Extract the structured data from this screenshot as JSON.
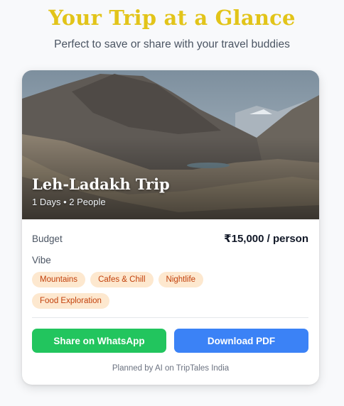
{
  "header": {
    "title": "Your Trip at a Glance",
    "subtitle": "Perfect to save or share with your travel buddies"
  },
  "card": {
    "hero": {
      "title": "Leh-Ladakh Trip",
      "meta": "1 Days • 2 People"
    },
    "budget": {
      "label": "Budget",
      "value": "₹15,000 / person"
    },
    "vibe": {
      "label": "Vibe",
      "tags": [
        "Mountains",
        "Cafes & Chill",
        "Nightlife",
        "Food Exploration"
      ]
    },
    "actions": {
      "whatsapp_label": "Share on WhatsApp",
      "pdf_label": "Download PDF"
    },
    "footer": "Planned by AI on TripTales India"
  },
  "colors": {
    "title": "#e2c419",
    "whatsapp": "#22c55e",
    "pdf": "#3b82f6",
    "tag_bg": "#fde8cf",
    "tag_text": "#c2410c"
  }
}
